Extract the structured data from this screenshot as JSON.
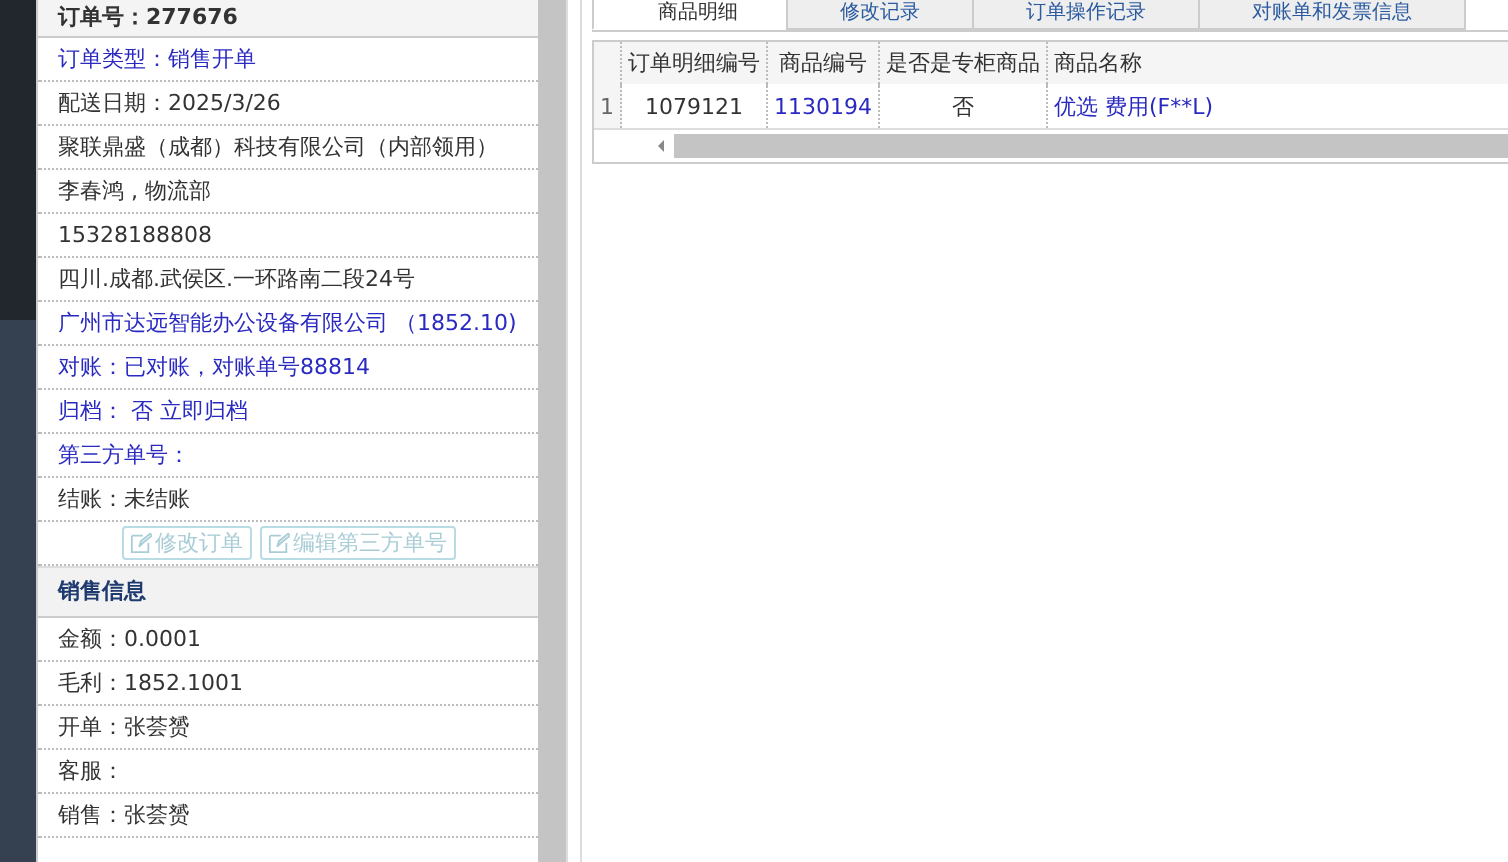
{
  "order_panel": {
    "title": "订单号：277676",
    "rows": [
      {
        "kind": "link",
        "text": "订单类型：销售开单"
      },
      {
        "kind": "plain",
        "text": "配送日期：2025/3/26"
      },
      {
        "kind": "plain",
        "text": "聚联鼎盛（成都）科技有限公司（内部领用）"
      },
      {
        "kind": "plain",
        "text": "李春鸿 , 物流部"
      },
      {
        "kind": "plain",
        "text": "15328188808"
      },
      {
        "kind": "plain",
        "text": "四川.成都.武侯区.一环路南二段24号"
      },
      {
        "kind": "link",
        "text": "广州市达远智能办公设备有限公司 （1852.10)"
      },
      {
        "kind": "link",
        "text": "对账：已对账，对账单号88814"
      },
      {
        "kind": "link",
        "text": "归档： 否 立即归档"
      },
      {
        "kind": "link",
        "text": "第三方单号："
      },
      {
        "kind": "plain",
        "text": "结账：未结账"
      }
    ],
    "buttons": [
      {
        "label": "修改订单",
        "disabled": true
      },
      {
        "label": "编辑第三方单号",
        "disabled": true
      }
    ]
  },
  "sales_panel": {
    "title": "销售信息",
    "rows": [
      "金额：0.0001",
      "毛利：1852.1001",
      "开单：张荟赟",
      "客服：",
      "销售：张荟赟"
    ]
  },
  "tabs": [
    {
      "label": "商品明细",
      "selected": true
    },
    {
      "label": "修改记录",
      "selected": false
    },
    {
      "label": "订单操作记录",
      "selected": false
    },
    {
      "label": "对账单和发票信息",
      "selected": false
    }
  ],
  "table": {
    "columns": [
      "订单明细编号",
      "商品编号",
      "是否是专柜商品",
      "商品名称"
    ],
    "rows": [
      {
        "index": "1",
        "cells": [
          "1079121",
          "1130194",
          "否",
          "优选 费用(F**L)"
        ]
      }
    ]
  }
}
